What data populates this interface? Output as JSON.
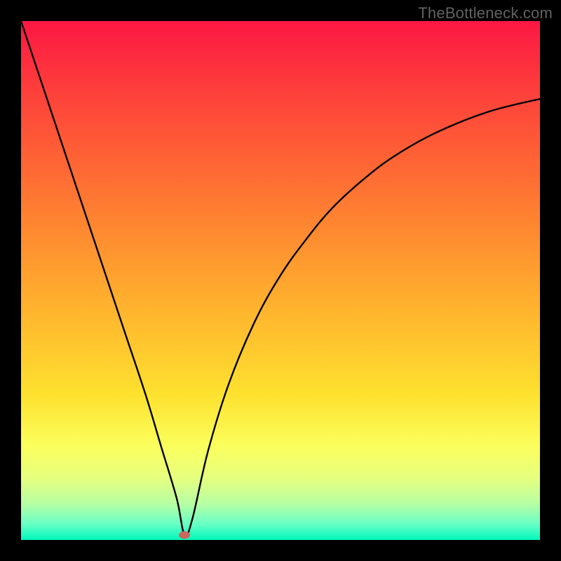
{
  "watermark": "TheBottleneck.com",
  "chart_data": {
    "type": "line",
    "title": "",
    "xlabel": "",
    "ylabel": "",
    "xlim": [
      0,
      100
    ],
    "ylim": [
      0,
      100
    ],
    "x": [
      0,
      4,
      8,
      12,
      16,
      20,
      24,
      27,
      30,
      31.5,
      33,
      36,
      40,
      45,
      50,
      55,
      60,
      66,
      72,
      80,
      90,
      100
    ],
    "values": [
      100,
      88,
      76,
      64,
      52,
      40,
      28,
      18,
      8,
      1,
      4,
      17,
      30,
      42,
      51,
      58,
      64,
      69.5,
      74,
      78.5,
      82.5,
      85
    ],
    "marker": {
      "x": 31.5,
      "y": 1
    },
    "gradient_bands": [
      {
        "color": "#fc1743",
        "stop": 0
      },
      {
        "color": "#ff8830",
        "stop": 40
      },
      {
        "color": "#fee12f",
        "stop": 72
      },
      {
        "color": "#fbff5d",
        "stop": 82
      },
      {
        "color": "#00f8bb",
        "stop": 100
      }
    ]
  }
}
